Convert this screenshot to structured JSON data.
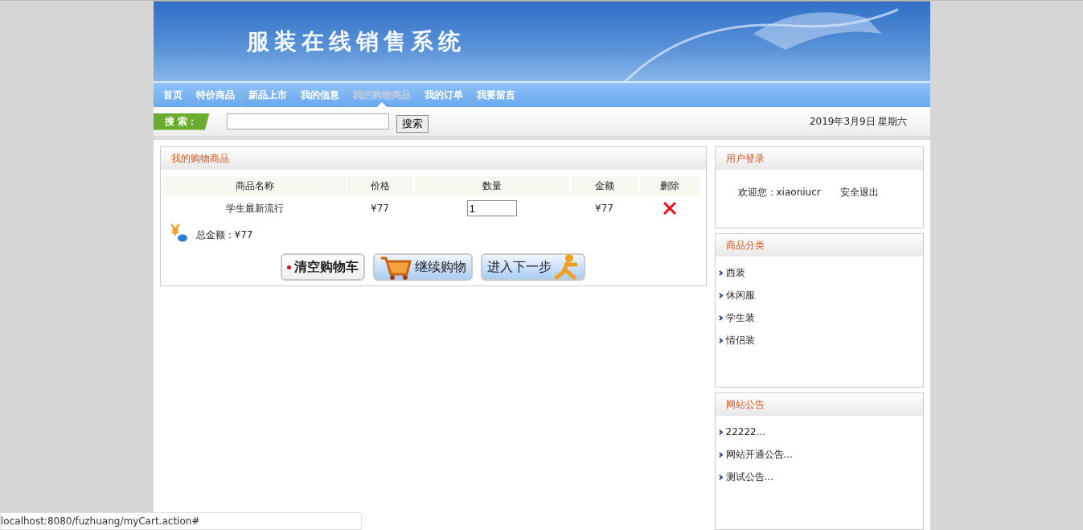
{
  "banner": {
    "title": "服装在线销售系统"
  },
  "nav": [
    {
      "label": "首页",
      "selected": false
    },
    {
      "label": "特价商品",
      "selected": false
    },
    {
      "label": "新品上市",
      "selected": false
    },
    {
      "label": "我的信息",
      "selected": false
    },
    {
      "label": "我的购物商品",
      "selected": true
    },
    {
      "label": "我的订单",
      "selected": false
    },
    {
      "label": "我要留言",
      "selected": false
    }
  ],
  "search": {
    "label": "搜 索：",
    "button": "搜索",
    "date": "2019年3月9日 星期六"
  },
  "cart": {
    "title": "我的购物商品",
    "columns": [
      "商品名称",
      "价格",
      "数量",
      "金额",
      "删除"
    ],
    "rows": [
      {
        "name": "学生最新流行",
        "price": "¥77",
        "quantity": "1",
        "amount": "¥77"
      }
    ],
    "total": "总金额：¥77",
    "buttons": [
      "清空购物车",
      "继续购物",
      "进入下一步"
    ]
  },
  "login": {
    "title": "用户登录",
    "welcome": "欢迎您：xiaoniucr",
    "logout": "安全退出"
  },
  "categories": {
    "title": "商品分类",
    "items": [
      "西装",
      "休闲服",
      "学生装",
      "情侣装"
    ]
  },
  "notices": {
    "title": "网站公告",
    "items": [
      "22222...",
      "网站开通公告...",
      "测试公告..."
    ]
  },
  "status_bar": {
    "url": "localhost:8080/fuzhuang/myCart.action#"
  }
}
